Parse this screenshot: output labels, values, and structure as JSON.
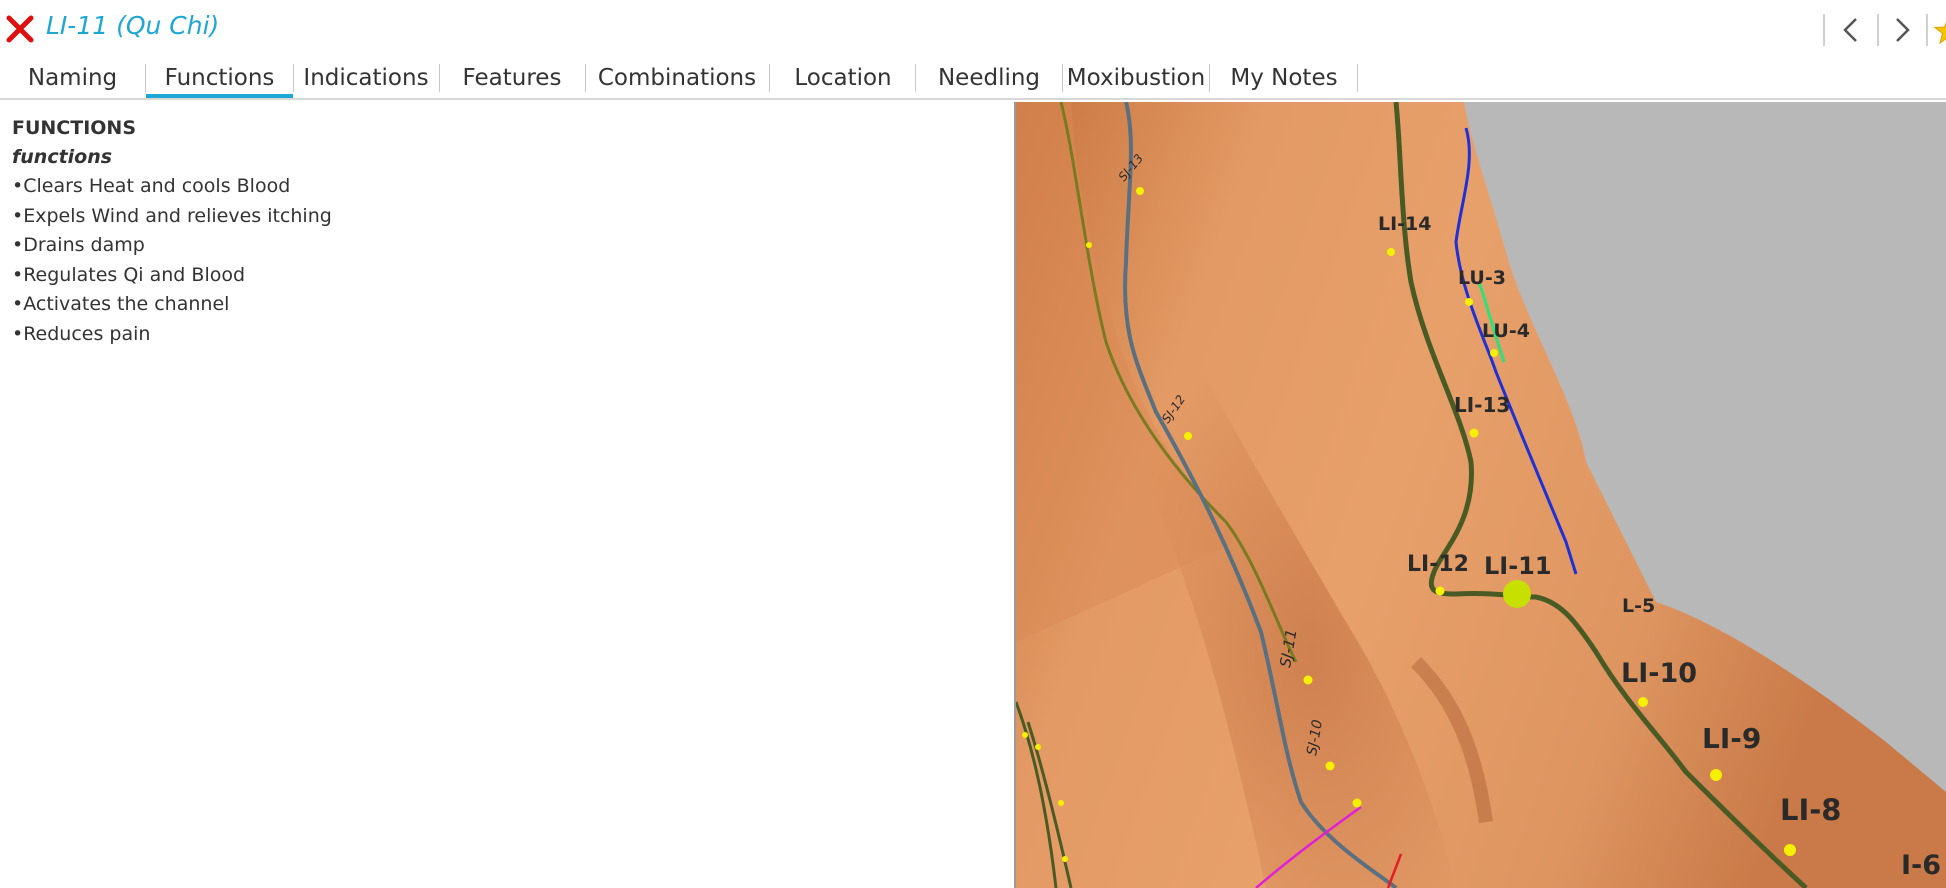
{
  "window": {
    "title": "LI-11 (Qu Chi)",
    "close_icon": "close-x-icon",
    "back_icon": "chevron-left-icon",
    "forward_icon": "chevron-right-icon",
    "favorite_icon": "star-icon",
    "accent_color": "#1ea7d4",
    "close_color": "#e01010"
  },
  "tabs": [
    {
      "label": "Naming",
      "active": false
    },
    {
      "label": "Functions",
      "active": true
    },
    {
      "label": "Indications",
      "active": false
    },
    {
      "label": "Features",
      "active": false
    },
    {
      "label": "Combinations",
      "active": false
    },
    {
      "label": "Location",
      "active": false
    },
    {
      "label": "Needling",
      "active": false
    },
    {
      "label": "Moxibustion",
      "active": false
    },
    {
      "label": "My Notes",
      "active": false
    }
  ],
  "content": {
    "heading": "FUNCTIONS",
    "subheading": "functions",
    "items": [
      "•Clears Heat and cools Blood",
      "•Expels Wind and relieves itching",
      "•Drains damp",
      "•Regulates Qi and Blood",
      "•Activates the channel",
      "•Reduces pain"
    ]
  },
  "viewer": {
    "labels": {
      "li14": "LI-14",
      "lu3": "LU-3",
      "lu4": "LU-4",
      "li13": "LI-13",
      "li12": "LI-12",
      "li11": "LI-11",
      "lu5": "L-5",
      "li10": "LI-10",
      "li9": "LI-9",
      "li8": "LI-8",
      "li6": "I-6",
      "sj13": "SJ-13",
      "sj12": "SJ-12",
      "sj11": "SJ-11",
      "sj10": "SJ-10"
    }
  }
}
